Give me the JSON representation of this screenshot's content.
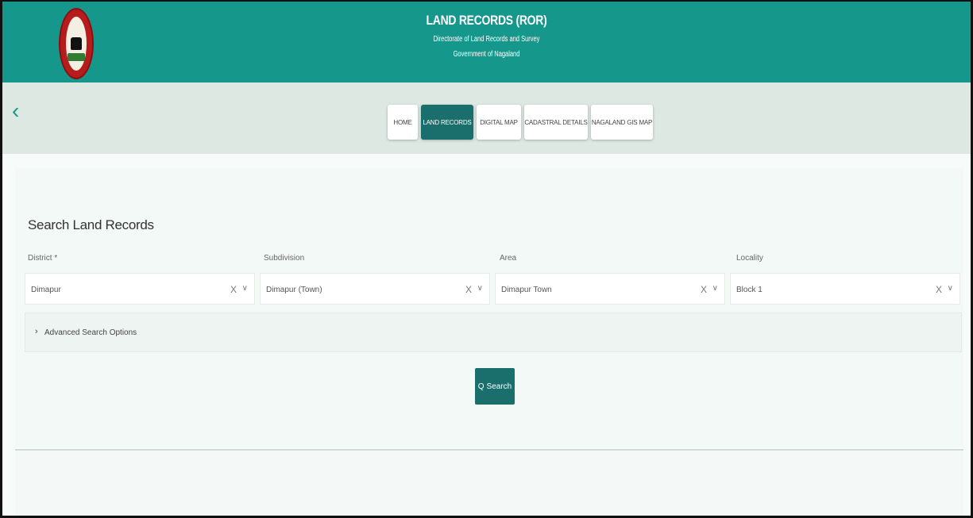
{
  "header": {
    "title": "LAND RECORDS (ROR)",
    "subtitle": "Directorate of Land Records and Survey",
    "subtitle2": "Government of Nagaland"
  },
  "nav": {
    "back": "‹",
    "tabs": [
      {
        "label": "HOME"
      },
      {
        "label": "LAND RECORDS"
      },
      {
        "label": "DIGITAL MAP"
      },
      {
        "label": "CADASTRAL DETAILS"
      },
      {
        "label": "NAGALAND GIS MAP"
      }
    ]
  },
  "search": {
    "title": "Search Land Records",
    "fields": [
      {
        "label": "District *",
        "value": "Dimapur",
        "clear": "X",
        "chevron": "∨"
      },
      {
        "label": "Subdivision",
        "value": "Dimapur (Town)",
        "clear": "X",
        "chevron": "∨"
      },
      {
        "label": "Area",
        "value": "Dimapur Town",
        "clear": "X",
        "chevron": "∨"
      },
      {
        "label": "Locality",
        "value": "Block 1",
        "clear": "X",
        "chevron": "∨"
      }
    ],
    "advanced": {
      "chevron": "›",
      "label": "Advanced Search Options"
    },
    "button": {
      "icon": "Q",
      "label": "Search"
    }
  },
  "colors": {
    "header_bg": "#15978c",
    "accent": "#1a6f6c",
    "nav_bg": "#dde8e2"
  }
}
